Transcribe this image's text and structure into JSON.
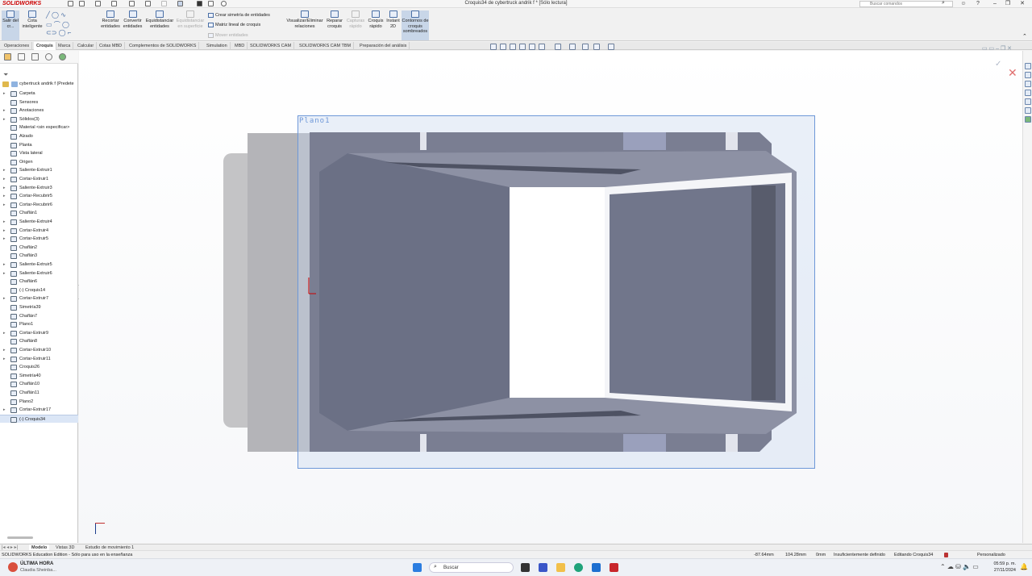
{
  "titlebar": {
    "app_logo": "SOLIDWORKS",
    "window_title": "Croquis34 de cybertruck andrik f * [Sólo lectura]",
    "search_placeholder": "Buscar comandos"
  },
  "ribbon": {
    "exit_sketch": "Salir del cr...",
    "smart_dimension": "Cota inteligente",
    "trim": "Recortar entidades",
    "convert": "Convertir entidades",
    "offset": "Equidistanciar entidades",
    "offset_surface": "Equidistanciar en superficie",
    "mirror": "Crear simetría de entidades",
    "linear_pattern": "Matriz lineal de croquis",
    "move": "Mover entidades",
    "relations": "Visualizar/Eliminar relaciones",
    "repair": "Reparar croquis",
    "quick_capture": "Capturas rápido",
    "quick_sketch": "Croquis rápido",
    "instant2d": "Instant 2D",
    "shaded_contours": "Contornos de croquis sombreados"
  },
  "tabs": [
    "Operaciones",
    "Croquis",
    "Marca",
    "Calcular",
    "Cotas MBD",
    "Complementos de SOLIDWORKS",
    "Simulation",
    "MBD",
    "SOLIDWORKS CAM",
    "SOLIDWORKS CAM TBM",
    "Preparación del análisis"
  ],
  "tree": {
    "root": "cybertruck andrik f (Predete",
    "items": [
      {
        "label": "Carpeta",
        "arrow": true
      },
      {
        "label": "Sensores",
        "arrow": false
      },
      {
        "label": "Anotaciones",
        "arrow": true
      },
      {
        "label": "Sólidos(3)",
        "arrow": true
      },
      {
        "label": "Material <sin especificar>",
        "arrow": false
      },
      {
        "label": "Alzado",
        "arrow": false
      },
      {
        "label": "Planta",
        "arrow": false
      },
      {
        "label": "Vista lateral",
        "arrow": false
      },
      {
        "label": "Origen",
        "arrow": false
      },
      {
        "label": "Saliente-Extruir1",
        "arrow": true
      },
      {
        "label": "Cortar-Extruir1",
        "arrow": true
      },
      {
        "label": "Saliente-Extruir3",
        "arrow": true
      },
      {
        "label": "Cortar-Recubrir5",
        "arrow": true
      },
      {
        "label": "Cortar-Recubrir6",
        "arrow": true
      },
      {
        "label": "Chaflán1",
        "arrow": false
      },
      {
        "label": "Saliente-Extruir4",
        "arrow": true
      },
      {
        "label": "Cortar-Extruir4",
        "arrow": true
      },
      {
        "label": "Cortar-Extruir5",
        "arrow": true
      },
      {
        "label": "Chaflán2",
        "arrow": false
      },
      {
        "label": "Chaflán3",
        "arrow": false
      },
      {
        "label": "Saliente-Extruir5",
        "arrow": true
      },
      {
        "label": "Saliente-Extruir6",
        "arrow": true
      },
      {
        "label": "Chaflán6",
        "arrow": false
      },
      {
        "label": "(-) Croquis14",
        "arrow": false
      },
      {
        "label": "Cortar-Extruir7",
        "arrow": true
      },
      {
        "label": "Simetría39",
        "arrow": false
      },
      {
        "label": "Chaflán7",
        "arrow": false
      },
      {
        "label": "Plano1",
        "arrow": false
      },
      {
        "label": "Cortar-Extruir9",
        "arrow": true
      },
      {
        "label": "Chaflán8",
        "arrow": false
      },
      {
        "label": "Cortar-Extruir10",
        "arrow": true
      },
      {
        "label": "Cortar-Extruir11",
        "arrow": true
      },
      {
        "label": "Croquis26",
        "arrow": false
      },
      {
        "label": "Simetría40",
        "arrow": false
      },
      {
        "label": "Chaflán10",
        "arrow": false
      },
      {
        "label": "Chaflán11",
        "arrow": false
      },
      {
        "label": "Plano2",
        "arrow": false
      },
      {
        "label": "Cortar-Extruir17",
        "arrow": true
      },
      {
        "label": "(-) Croquis34",
        "arrow": false
      }
    ]
  },
  "viewport": {
    "plane_label": "Plano1"
  },
  "bottom_tabs": [
    "Modelo",
    "Vistas 3D",
    "Estudio de movimiento 1"
  ],
  "status": {
    "left": "SOLIDWORKS Education Edition - Sólo para uso en la enseñanza",
    "x": "-87.64mm",
    "y": "104.28mm",
    "z": "0mm",
    "state": "Insuficientemente definido",
    "editing": "Editando Croquis34",
    "units": "Personalizado"
  },
  "taskbar": {
    "news_title": "ÚLTIMA HORA",
    "news_sub": "Claudia Sheinba...",
    "search": "Buscar",
    "time": "05:59 p. m.",
    "date": "27/11/2024"
  }
}
